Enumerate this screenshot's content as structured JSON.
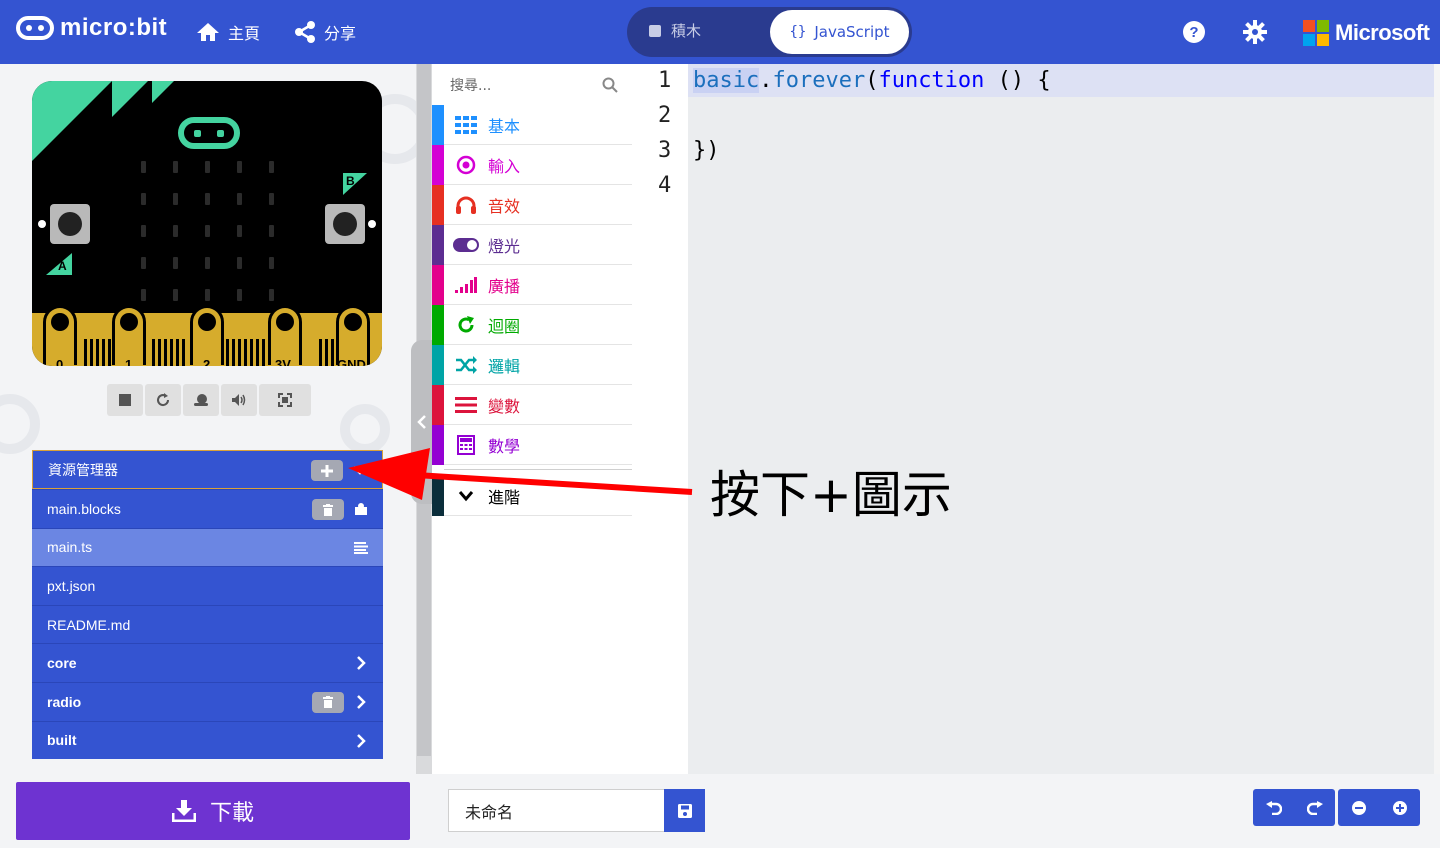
{
  "brand": {
    "name": "micro:bit"
  },
  "nav": {
    "home": "主頁",
    "share": "分享"
  },
  "mode": {
    "blocks": "積木",
    "javascript": "JavaScript"
  },
  "ms": {
    "name": "Microsoft"
  },
  "board": {
    "button_a": "A",
    "button_b": "B",
    "pins": [
      "0",
      "1",
      "2",
      "3V",
      "GND"
    ]
  },
  "explorer": {
    "title": "資源管理器",
    "files": [
      {
        "name": "main.blocks"
      },
      {
        "name": "main.ts"
      },
      {
        "name": "pxt.json"
      },
      {
        "name": "README.md"
      },
      {
        "name": "core"
      },
      {
        "name": "radio"
      },
      {
        "name": "built"
      }
    ]
  },
  "toolbox": {
    "search_placeholder": "搜尋...",
    "categories": [
      {
        "label": "基本",
        "color": "#1e90ff"
      },
      {
        "label": "輸入",
        "color": "#d400d4"
      },
      {
        "label": "音效",
        "color": "#e63022"
      },
      {
        "label": "燈光",
        "color": "#5c2d91"
      },
      {
        "label": "廣播",
        "color": "#e3008c"
      },
      {
        "label": "迴圈",
        "color": "#00aa00"
      },
      {
        "label": "邏輯",
        "color": "#00a4a6"
      },
      {
        "label": "變數",
        "color": "#dc143c"
      },
      {
        "label": "數學",
        "color": "#9400d3"
      },
      {
        "label": "進階",
        "color": "#000000"
      }
    ]
  },
  "editor": {
    "line_numbers": [
      "1",
      "2",
      "3",
      "4"
    ],
    "code": {
      "l1_obj": "basic",
      "l1_dot": ".",
      "l1_fn": "forever",
      "l1_open": "(",
      "l1_kw": "function",
      "l1_rest": " () {",
      "l3": "})"
    }
  },
  "annotation": {
    "text": "按下+圖示",
    "arrow_color": "#ff0000"
  },
  "bottom": {
    "download": "下載",
    "project_name": "未命名"
  },
  "colors": {
    "header": "#3454d1",
    "download": "#6e33d1",
    "accent_green": "#44d4a0",
    "edge_gold": "#d6ac2c"
  }
}
